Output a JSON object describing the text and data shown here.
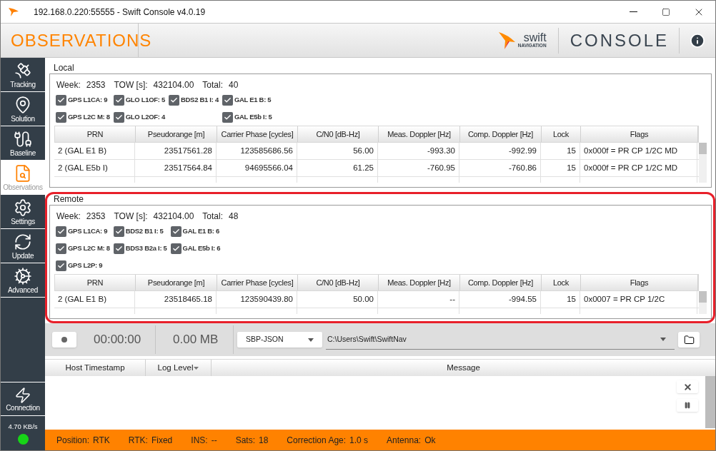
{
  "window": {
    "title": "192.168.0.220:55555 - Swift Console v4.0.19"
  },
  "header": {
    "page_title": "OBSERVATIONS",
    "logo_word": "swift",
    "logo_sub": "NAVIGATION",
    "product": "CONSOLE"
  },
  "sidebar": {
    "items": [
      {
        "label": "Tracking",
        "kind": "tracking",
        "selected": false
      },
      {
        "label": "Solution",
        "kind": "solution",
        "selected": false
      },
      {
        "label": "Baseline",
        "kind": "baseline",
        "selected": false
      },
      {
        "label": "Observations",
        "kind": "observations",
        "selected": true
      },
      {
        "label": "Settings",
        "kind": "settings",
        "selected": false
      },
      {
        "label": "Update",
        "kind": "update",
        "selected": false
      },
      {
        "label": "Advanced",
        "kind": "advanced",
        "selected": false
      }
    ],
    "connection": {
      "label": "Connection",
      "rate": "4.70 KB/s",
      "connected": true
    }
  },
  "panels": [
    {
      "title": "Local",
      "stats": [
        {
          "label": "Week:",
          "value": "2353"
        },
        {
          "label": "TOW [s]:",
          "value": "432104.00"
        },
        {
          "label": "Total:",
          "value": "40"
        }
      ],
      "filter_columns": [
        [
          {
            "label": "GPS L1CA: 9",
            "checked": true
          },
          {
            "label": "GPS L2C M: 8",
            "checked": true
          }
        ],
        [
          {
            "label": "GLO L1OF: 5",
            "checked": true
          },
          {
            "label": "GLO L2OF: 4",
            "checked": true
          }
        ],
        [
          {
            "label": "BDS2 B1 I: 4",
            "checked": true
          }
        ],
        [
          {
            "label": "GAL E1 B: 5",
            "checked": true
          },
          {
            "label": "GAL E5b I: 5",
            "checked": true
          }
        ]
      ],
      "columns": [
        "PRN",
        "Pseudorange [m]",
        "Carrier Phase [cycles]",
        "C/N0 [dB-Hz]",
        "Meas. Doppler [Hz]",
        "Comp. Doppler [Hz]",
        "Lock",
        "Flags"
      ],
      "rows": [
        [
          "2 (GAL E1 B)",
          "23517561.28",
          "123585686.56",
          "56.00",
          "-993.30",
          "-992.99",
          "15",
          "0x000f = PR CP 1/2C MD"
        ],
        [
          "2 (GAL E5b I)",
          "23517564.84",
          "94695566.04",
          "61.25",
          "-760.95",
          "-760.86",
          "15",
          "0x000f = PR CP 1/2C MD"
        ]
      ],
      "highlighted": false
    },
    {
      "title": "Remote",
      "stats": [
        {
          "label": "Week:",
          "value": "2353"
        },
        {
          "label": "TOW [s]:",
          "value": "432104.00"
        },
        {
          "label": "Total:",
          "value": "48"
        }
      ],
      "filter_columns": [
        [
          {
            "label": "GPS L1CA: 9",
            "checked": true
          },
          {
            "label": "GPS L2C M: 8",
            "checked": true
          },
          {
            "label": "GPS L2P: 9",
            "checked": true
          }
        ],
        [
          {
            "label": "BDS2 B1 I: 5",
            "checked": true
          },
          {
            "label": "BDS3 B2a I: 5",
            "checked": true
          }
        ],
        [
          {
            "label": "GAL E1 B: 6",
            "checked": true
          },
          {
            "label": "GAL E5b I: 6",
            "checked": true
          }
        ]
      ],
      "columns": [
        "PRN",
        "Pseudorange [m]",
        "Carrier Phase [cycles]",
        "C/N0 [dB-Hz]",
        "Meas. Doppler [Hz]",
        "Comp. Doppler [Hz]",
        "Lock",
        "Flags"
      ],
      "rows": [
        [
          "2 (GAL E1 B)",
          "23518465.18",
          "123590439.80",
          "50.00",
          "--",
          "-994.55",
          "15",
          "0x0007 = PR CP 1/2C"
        ]
      ],
      "highlighted": true
    }
  ],
  "recorder": {
    "time": "00:00:00",
    "size": "0.00 MB",
    "format": "SBP-JSON",
    "path": "C:\\Users\\Swift\\SwiftNav"
  },
  "log": {
    "columns": [
      {
        "label": "Host Timestamp",
        "filter": false
      },
      {
        "label": "Log Level",
        "filter": true
      },
      {
        "label": "Message",
        "filter": false
      }
    ]
  },
  "status_bar": [
    {
      "label": "Position:",
      "value": "RTK"
    },
    {
      "label": "RTK:",
      "value": "Fixed"
    },
    {
      "label": "INS:",
      "value": "--"
    },
    {
      "label": "Sats:",
      "value": "18"
    },
    {
      "label": "Correction Age:",
      "value": "1.0 s"
    },
    {
      "label": "Antenna:",
      "value": "Ok"
    }
  ]
}
